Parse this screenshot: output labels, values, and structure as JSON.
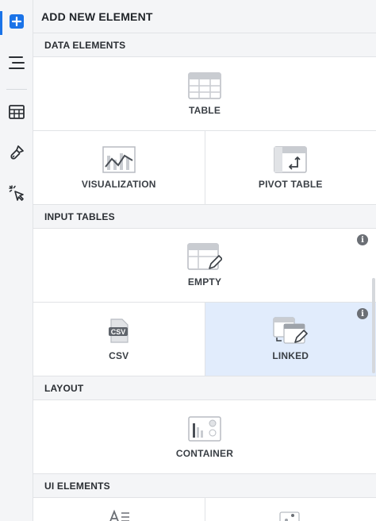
{
  "title": "ADD NEW ELEMENT",
  "sections": {
    "data_elements": {
      "label": "DATA ELEMENTS",
      "table": "TABLE",
      "visualization": "VISUALIZATION",
      "pivot_table": "PIVOT TABLE"
    },
    "input_tables": {
      "label": "INPUT TABLES",
      "empty": "EMPTY",
      "csv": "CSV",
      "linked": "LINKED",
      "csv_icon_text": "CSV"
    },
    "layout": {
      "label": "LAYOUT",
      "container": "CONTAINER"
    },
    "ui_elements": {
      "label": "UI ELEMENTS"
    }
  },
  "sidebar": {
    "items": [
      {
        "icon": "add-icon",
        "selected": true
      },
      {
        "icon": "outline-icon"
      },
      {
        "icon": "table-icon"
      },
      {
        "icon": "paintbrush-icon"
      },
      {
        "icon": "cursor-click-icon"
      }
    ]
  },
  "colors": {
    "accent": "#1a73e8",
    "selected_tile": "#e1ecfc"
  }
}
